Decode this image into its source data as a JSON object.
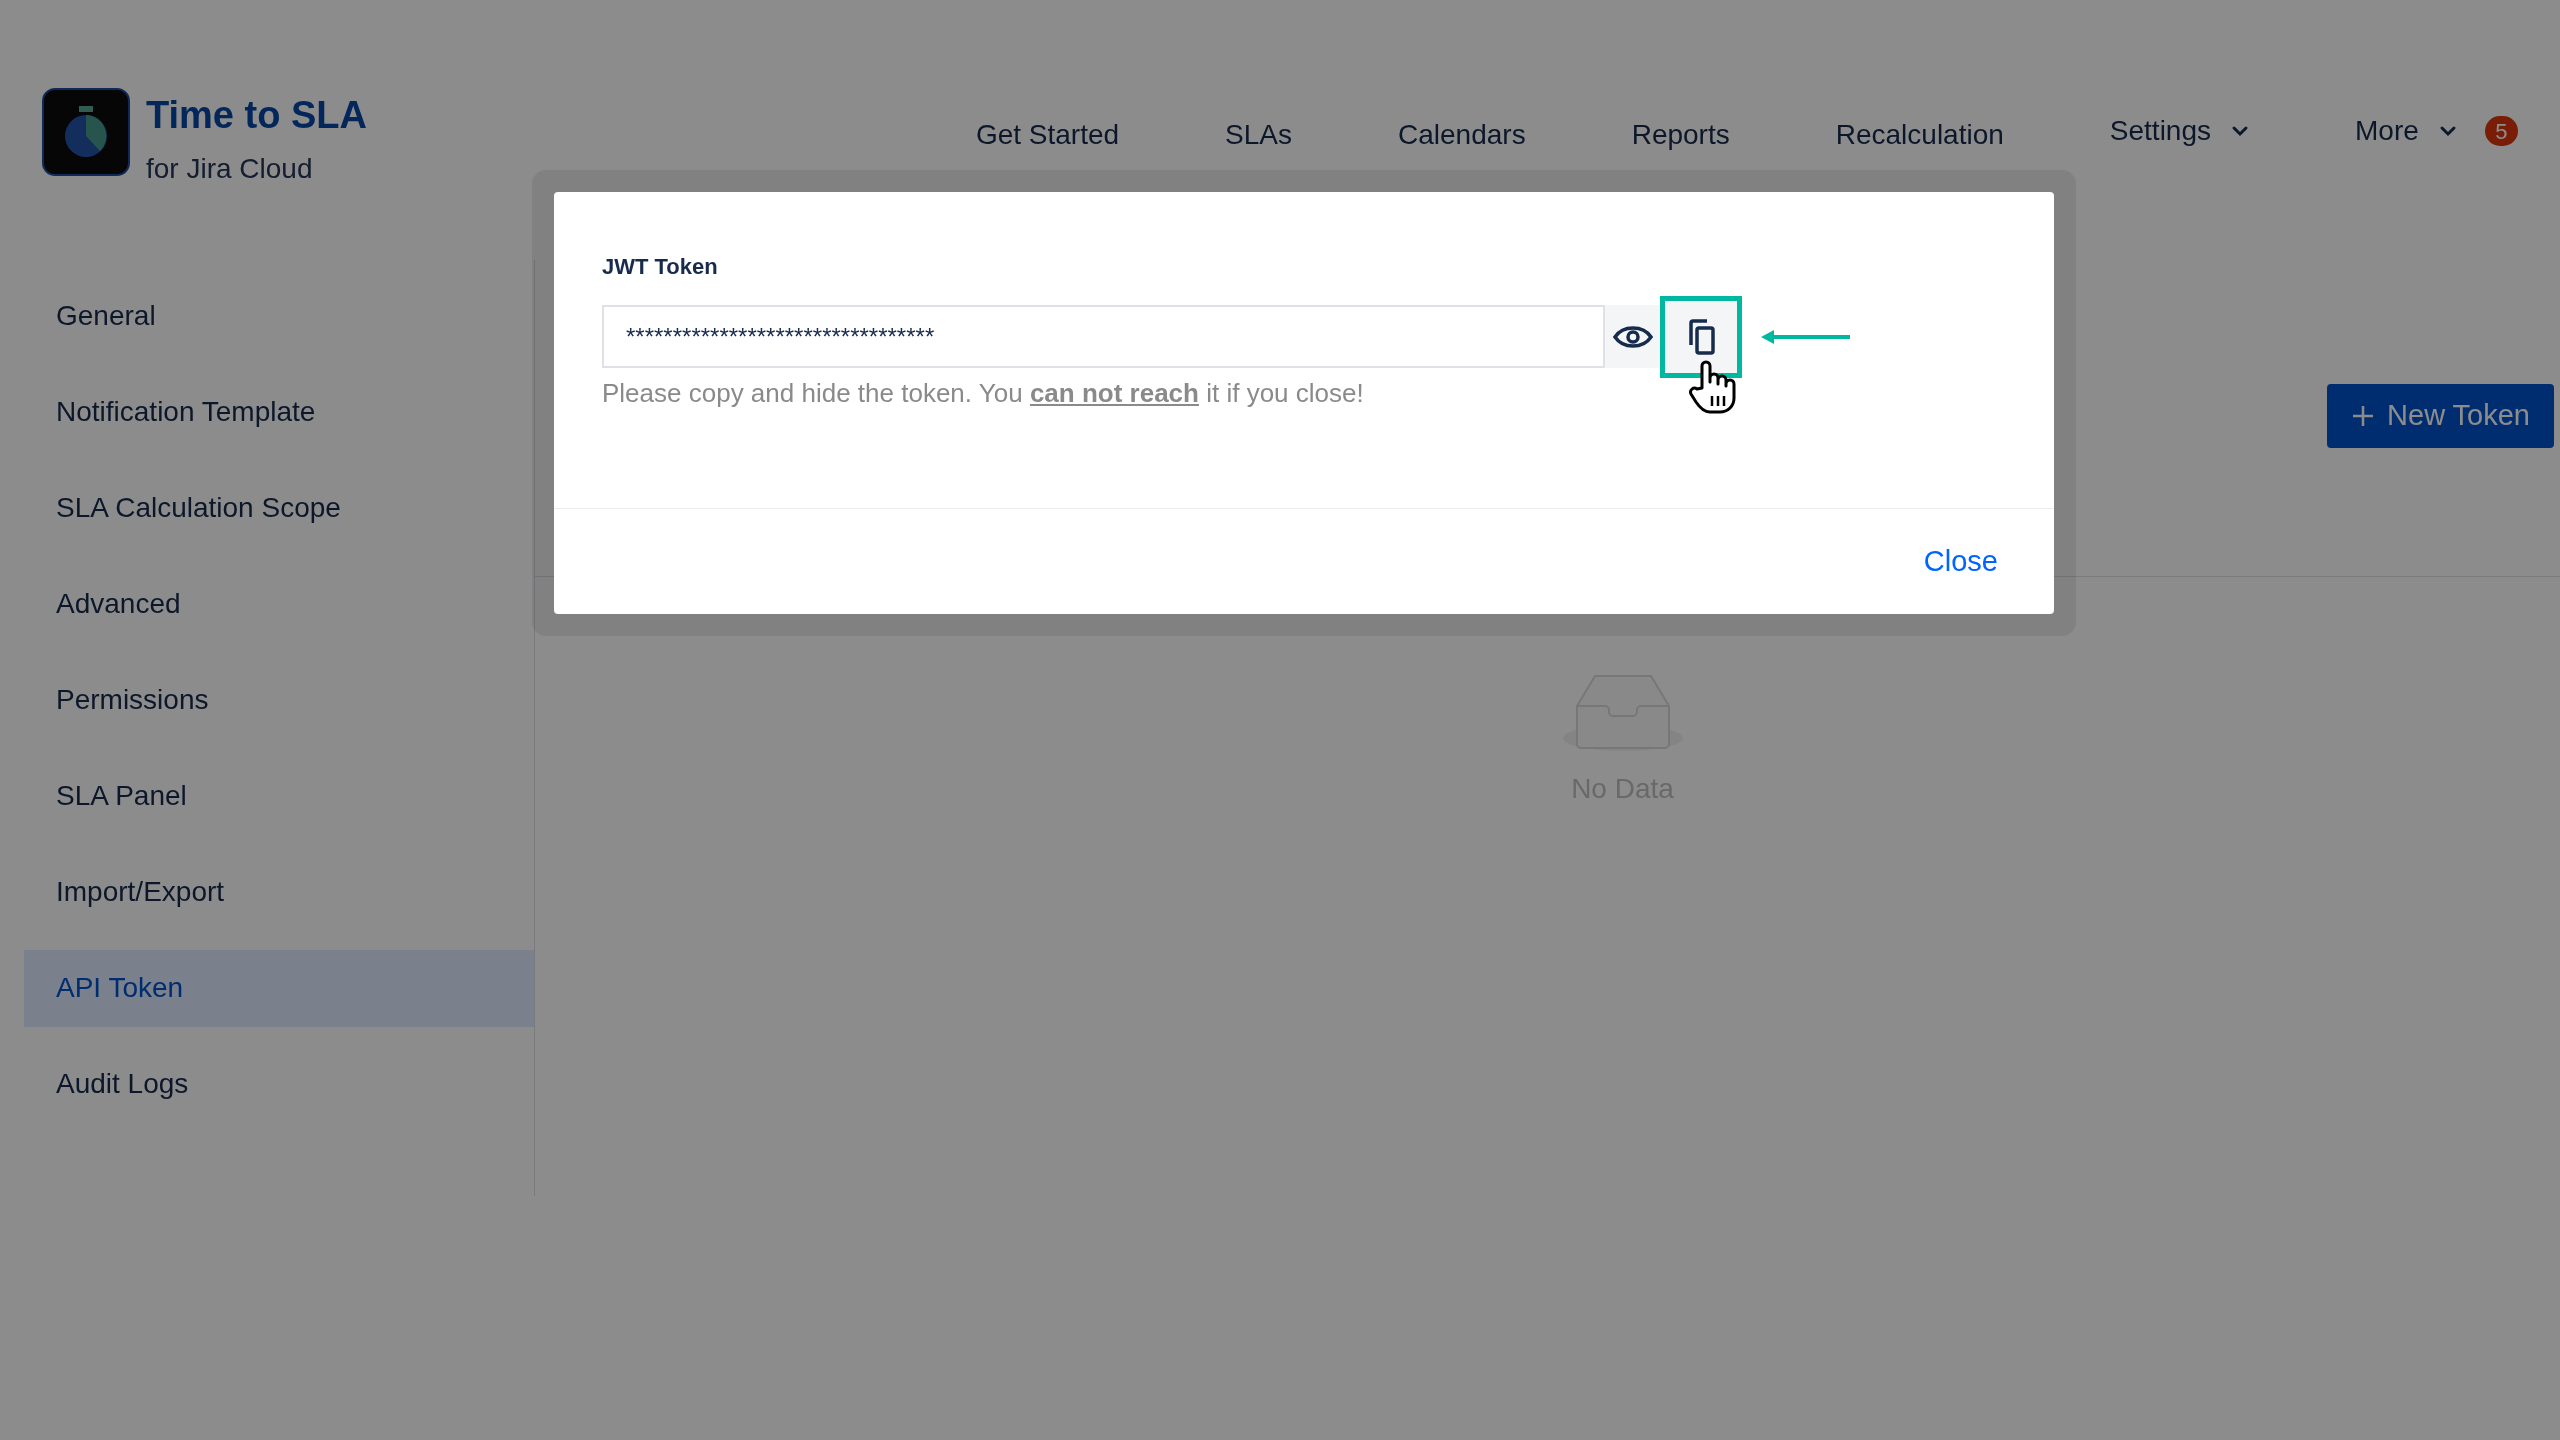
{
  "app": {
    "title": "Time to SLA",
    "subtitle": "for Jira Cloud"
  },
  "nav": [
    {
      "label": "Get Started",
      "kind": "link"
    },
    {
      "label": "SLAs",
      "kind": "link"
    },
    {
      "label": "Calendars",
      "kind": "link"
    },
    {
      "label": "Reports",
      "kind": "link"
    },
    {
      "label": "Recalculation",
      "kind": "link"
    },
    {
      "label": "Settings",
      "kind": "dropdown"
    },
    {
      "label": "More",
      "kind": "dropdown"
    }
  ],
  "notification_badge": "5",
  "sidebar": {
    "items": [
      {
        "label": "General",
        "selected": false
      },
      {
        "label": "Notification Template",
        "selected": false
      },
      {
        "label": "SLA Calculation Scope",
        "selected": false
      },
      {
        "label": "Advanced",
        "selected": false
      },
      {
        "label": "Permissions",
        "selected": false
      },
      {
        "label": "SLA Panel",
        "selected": false
      },
      {
        "label": "Import/Export",
        "selected": false
      },
      {
        "label": "API Token",
        "selected": true
      },
      {
        "label": "Audit Logs",
        "selected": false
      }
    ]
  },
  "new_token_button": "New Token",
  "empty_state": "No Data",
  "modal": {
    "label": "JWT Token",
    "value": "*********************************",
    "helper_before": "Please copy and hide the token. You ",
    "helper_link": "can not reach",
    "helper_after": " it if you close!",
    "close_button": "Close"
  }
}
